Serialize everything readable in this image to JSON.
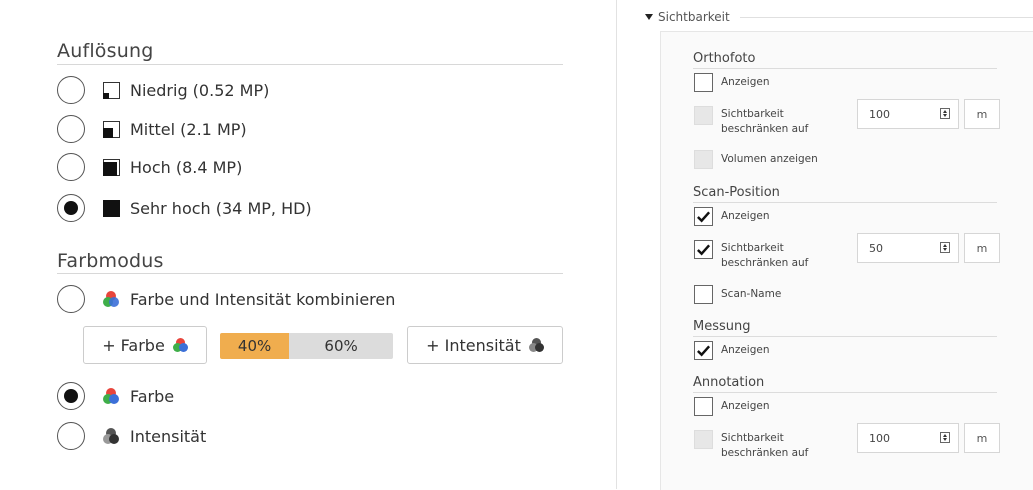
{
  "resolution": {
    "title": "Auflösung",
    "options": [
      {
        "label": "Niedrig (0.52 MP)",
        "selected": false
      },
      {
        "label": "Mittel (2.1 MP)",
        "selected": false
      },
      {
        "label": "Hoch (8.4 MP)",
        "selected": false
      },
      {
        "label": "Sehr hoch (34 MP, HD)",
        "selected": true
      }
    ]
  },
  "color_mode": {
    "title": "Farbmodus",
    "combined_label": "Farbe und Intensität kombinieren",
    "farbe_button": "+ Farbe",
    "intensity_button": "+ Intensität",
    "ratio_color": "40%",
    "ratio_intensity": "60%",
    "ratio_color_fraction": 0.4,
    "color_label": "Farbe",
    "intensity_label": "Intensität",
    "selected": "color"
  },
  "visibility": {
    "header": "Sichtbarkeit",
    "groups": [
      {
        "title": "Orthofoto",
        "show_label": "Anzeigen",
        "show_checked": false,
        "limit_label_1": "Sichtbarkeit",
        "limit_label_2": "beschränken auf",
        "limit_value": "100",
        "limit_unit": "m",
        "limit_enabled": false,
        "volume_label": "Volumen anzeigen"
      },
      {
        "title": "Scan-Position",
        "show_label": "Anzeigen",
        "show_checked": true,
        "limit_label_1": "Sichtbarkeit",
        "limit_label_2": "beschränken auf",
        "limit_value": "50",
        "limit_unit": "m",
        "limit_checked": true,
        "name_label": "Scan-Name",
        "name_checked": false
      },
      {
        "title": "Messung",
        "show_label": "Anzeigen",
        "show_checked": true
      },
      {
        "title": "Annotation",
        "show_label": "Anzeigen",
        "show_checked": false,
        "limit_label_1": "Sichtbarkeit",
        "limit_label_2": "beschränken auf",
        "limit_value": "100",
        "limit_unit": "m",
        "limit_enabled": false
      }
    ]
  },
  "colors": {
    "accent_orange": "#f0ad4e",
    "ratio_gray": "#dcdcdc",
    "icon_red": "#e8453c",
    "icon_green": "#3fae49",
    "icon_blue": "#3b6fd8"
  }
}
